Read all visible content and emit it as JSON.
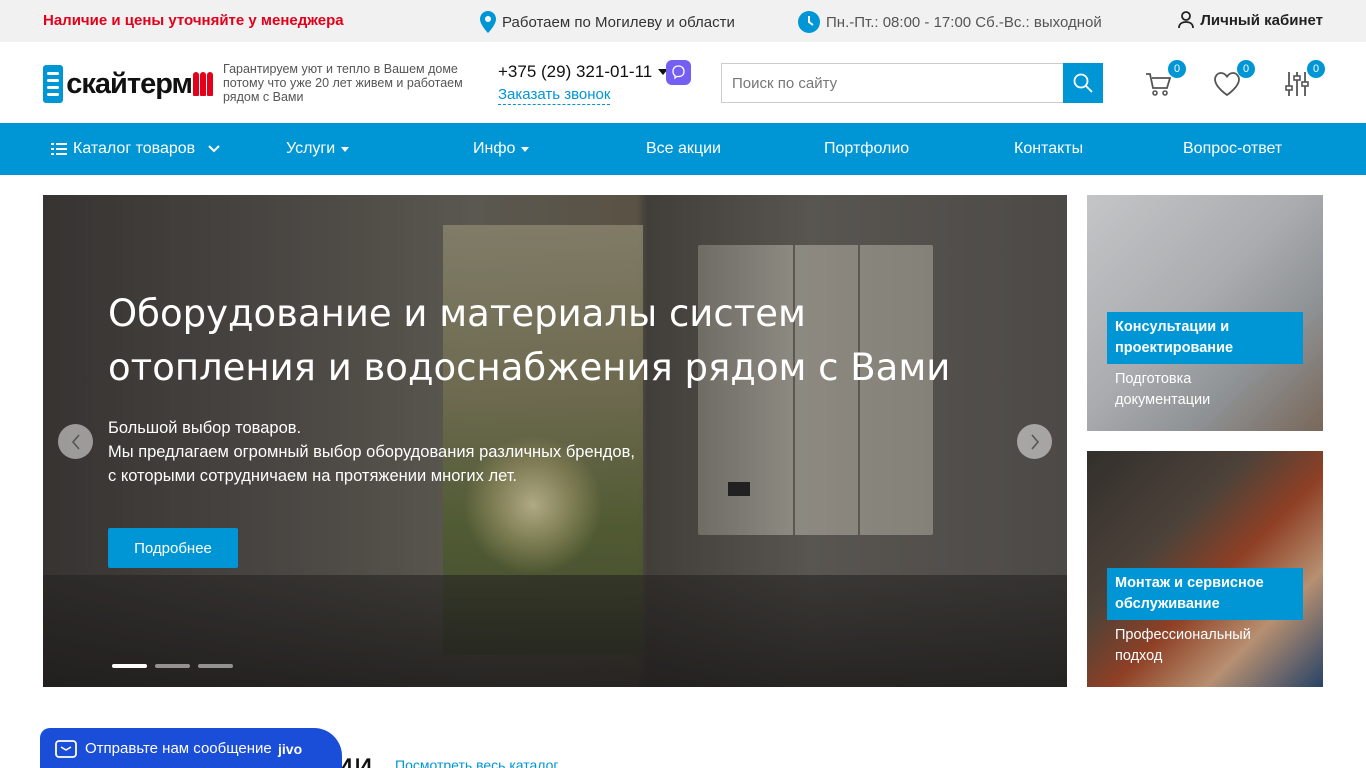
{
  "topbar": {
    "notice": "Наличие и цены уточняйте у менеджера",
    "region": "Работаем по Могилеву и области",
    "hours": "Пн.-Пт.: 08:00 - 17:00 Сб.-Вс.: выходной",
    "account": "Личный кабинет"
  },
  "header": {
    "logo_text": "скайтерм",
    "tagline": "Гарантируем уют и тепло в Вашем доме потому что уже 20 лет живем и работаем рядом с Вами",
    "phone": "+375 (29) 321-01-11",
    "callback": "Заказать звонок",
    "search_placeholder": "Поиск по сайту",
    "cart_count": "0",
    "favorites_count": "0",
    "compare_count": "0"
  },
  "nav": {
    "catalog": "Каталог товаров",
    "services": "Услуги",
    "info": "Инфо",
    "promos": "Все акции",
    "portfolio": "Портфолио",
    "contacts": "Контакты",
    "faq": "Вопрос-ответ"
  },
  "hero": {
    "title": "Оборудование и материалы систем отопления и водоснабжения рядом с Вами",
    "desc_line1": "Большой выбор товаров.",
    "desc_line2": "Мы предлагаем огромный выбор оборудования различных брендов,",
    "desc_line3": "с которыми сотрудничаем на протяжении многих лет.",
    "button": "Подробнее",
    "slides": 3,
    "active_slide": 1
  },
  "side_banners": [
    {
      "title": "Консультации и проектирование",
      "subtitle": "Подготовка документации"
    },
    {
      "title": "Монтаж и сервисное обслуживание",
      "subtitle": "Профессиональный подход"
    }
  ],
  "section": {
    "title_fragment": "ии",
    "catalog_link": "Посмотреть весь каталог"
  },
  "chat": {
    "label": "Отправьте нам сообщение",
    "brand": "jivo"
  },
  "colors": {
    "accent": "#0096d6",
    "notice_red": "#e3001b",
    "chat_blue": "#1a4dd8"
  }
}
